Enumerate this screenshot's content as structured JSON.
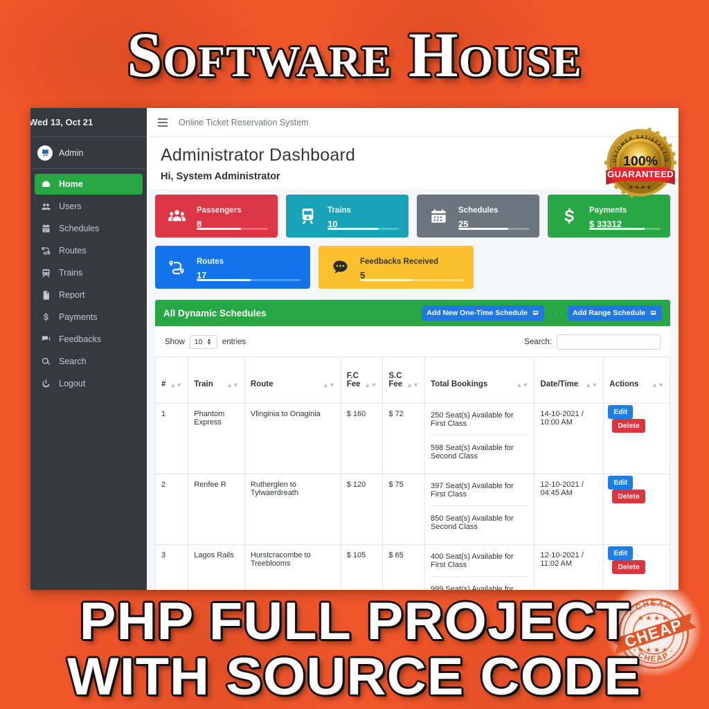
{
  "promo": {
    "title": "Software House",
    "bottom_line1": "PHP FULL PROJECT",
    "bottom_line2": "WITH SOURCE CODE",
    "guarantee_badge": {
      "arc_text": "CUSTOMER SATISFACTION",
      "percent": "100%",
      "ribbon": "GUARANTEED"
    },
    "cheap_stamp": {
      "banner": "CHEAP",
      "ring_top": "CHEAP",
      "ring_bottom": "CHEAP"
    },
    "colors": {
      "background": "#f0562a",
      "outline": "#12100e"
    }
  },
  "app": {
    "sidebar": {
      "date": "Wed 13, Oct 21",
      "user": "Admin",
      "items": [
        {
          "label": "Home",
          "icon": "tachometer-icon",
          "active": true
        },
        {
          "label": "Users",
          "icon": "users-icon",
          "active": false
        },
        {
          "label": "Schedules",
          "icon": "calendar-icon",
          "active": false
        },
        {
          "label": "Routes",
          "icon": "route-icon",
          "active": false
        },
        {
          "label": "Trains",
          "icon": "train-icon",
          "active": false
        },
        {
          "label": "Report",
          "icon": "report-icon",
          "active": false
        },
        {
          "label": "Payments",
          "icon": "dollar-icon",
          "active": false
        },
        {
          "label": "Feedbacks",
          "icon": "feedback-icon",
          "active": false
        },
        {
          "label": "Search",
          "icon": "search-icon",
          "active": false
        },
        {
          "label": "Logout",
          "icon": "power-icon",
          "active": false
        }
      ]
    },
    "topbar": {
      "brand": "Online Ticket Reservation System"
    },
    "header": {
      "title": "Administrator Dashboard",
      "greeting": "Hi, System Administrator"
    },
    "stats": [
      {
        "label": "Passengers",
        "value": "8",
        "icon": "passengers-icon",
        "color": "#dc3545",
        "progress": 62
      },
      {
        "label": "Trains",
        "value": "10",
        "icon": "train-icon",
        "color": "#17a2b8",
        "progress": 72
      },
      {
        "label": "Schedules",
        "value": "25",
        "icon": "calendar-icon",
        "color": "#6c757d",
        "progress": 70
      },
      {
        "label": "Payments",
        "value": "$ 33312",
        "icon": "dollar-icon",
        "color": "#28a745",
        "progress": 78
      },
      {
        "label": "Routes",
        "value": "17",
        "icon": "route-icon",
        "color": "#1273eb",
        "progress": 52
      },
      {
        "label": "Feedbacks Received",
        "value": "5",
        "icon": "comment-icon",
        "color": "#fbc02d",
        "progress": 50
      }
    ],
    "panel": {
      "title": "All Dynamic Schedules",
      "btn_onetime": "Add New One-Time Schedule",
      "btn_range": "Add Range Schedule",
      "separator": "· · ·"
    },
    "table_tools": {
      "show_label": "Show",
      "entries_label": "entries",
      "page_size": "10",
      "search_label": "Search:",
      "search_value": ""
    },
    "table": {
      "columns": [
        "#",
        "Train",
        "Route",
        "F.C\nFee",
        "S.C\nFee",
        "Total Bookings",
        "Date/Time",
        "Actions"
      ],
      "rows": [
        {
          "num": "1",
          "train": "Phantom Express",
          "route": "Vlinginia to Onaginia",
          "fc_fee": "$ 160",
          "sc_fee": "$ 72",
          "first_class": "250 Seat(s) Available for First Class",
          "second_class": "598 Seat(s) Available for Second Class",
          "datetime": "14-10-2021 / 10:00 AM",
          "edit": "Edit",
          "delete": "Delete"
        },
        {
          "num": "2",
          "train": "Renfee R",
          "route": "Rutherglen to Tylwaerdreath",
          "fc_fee": "$ 120",
          "sc_fee": "$ 75",
          "first_class": "397 Seat(s) Available for First Class",
          "second_class": "850 Seat(s) Available for Second Class",
          "datetime": "12-10-2021 / 04:45 AM",
          "edit": "Edit",
          "delete": "Delete"
        },
        {
          "num": "3",
          "train": "Lagos Rails",
          "route": "Hurstcracombe to Treeblooms",
          "fc_fee": "$ 105",
          "sc_fee": "$ 65",
          "first_class": "400 Seat(s) Available for First Class",
          "second_class": "999 Seat(s) Available for",
          "datetime": "12-10-2021 / 11:02 AM",
          "edit": "Edit",
          "delete": "Delete"
        }
      ]
    }
  }
}
